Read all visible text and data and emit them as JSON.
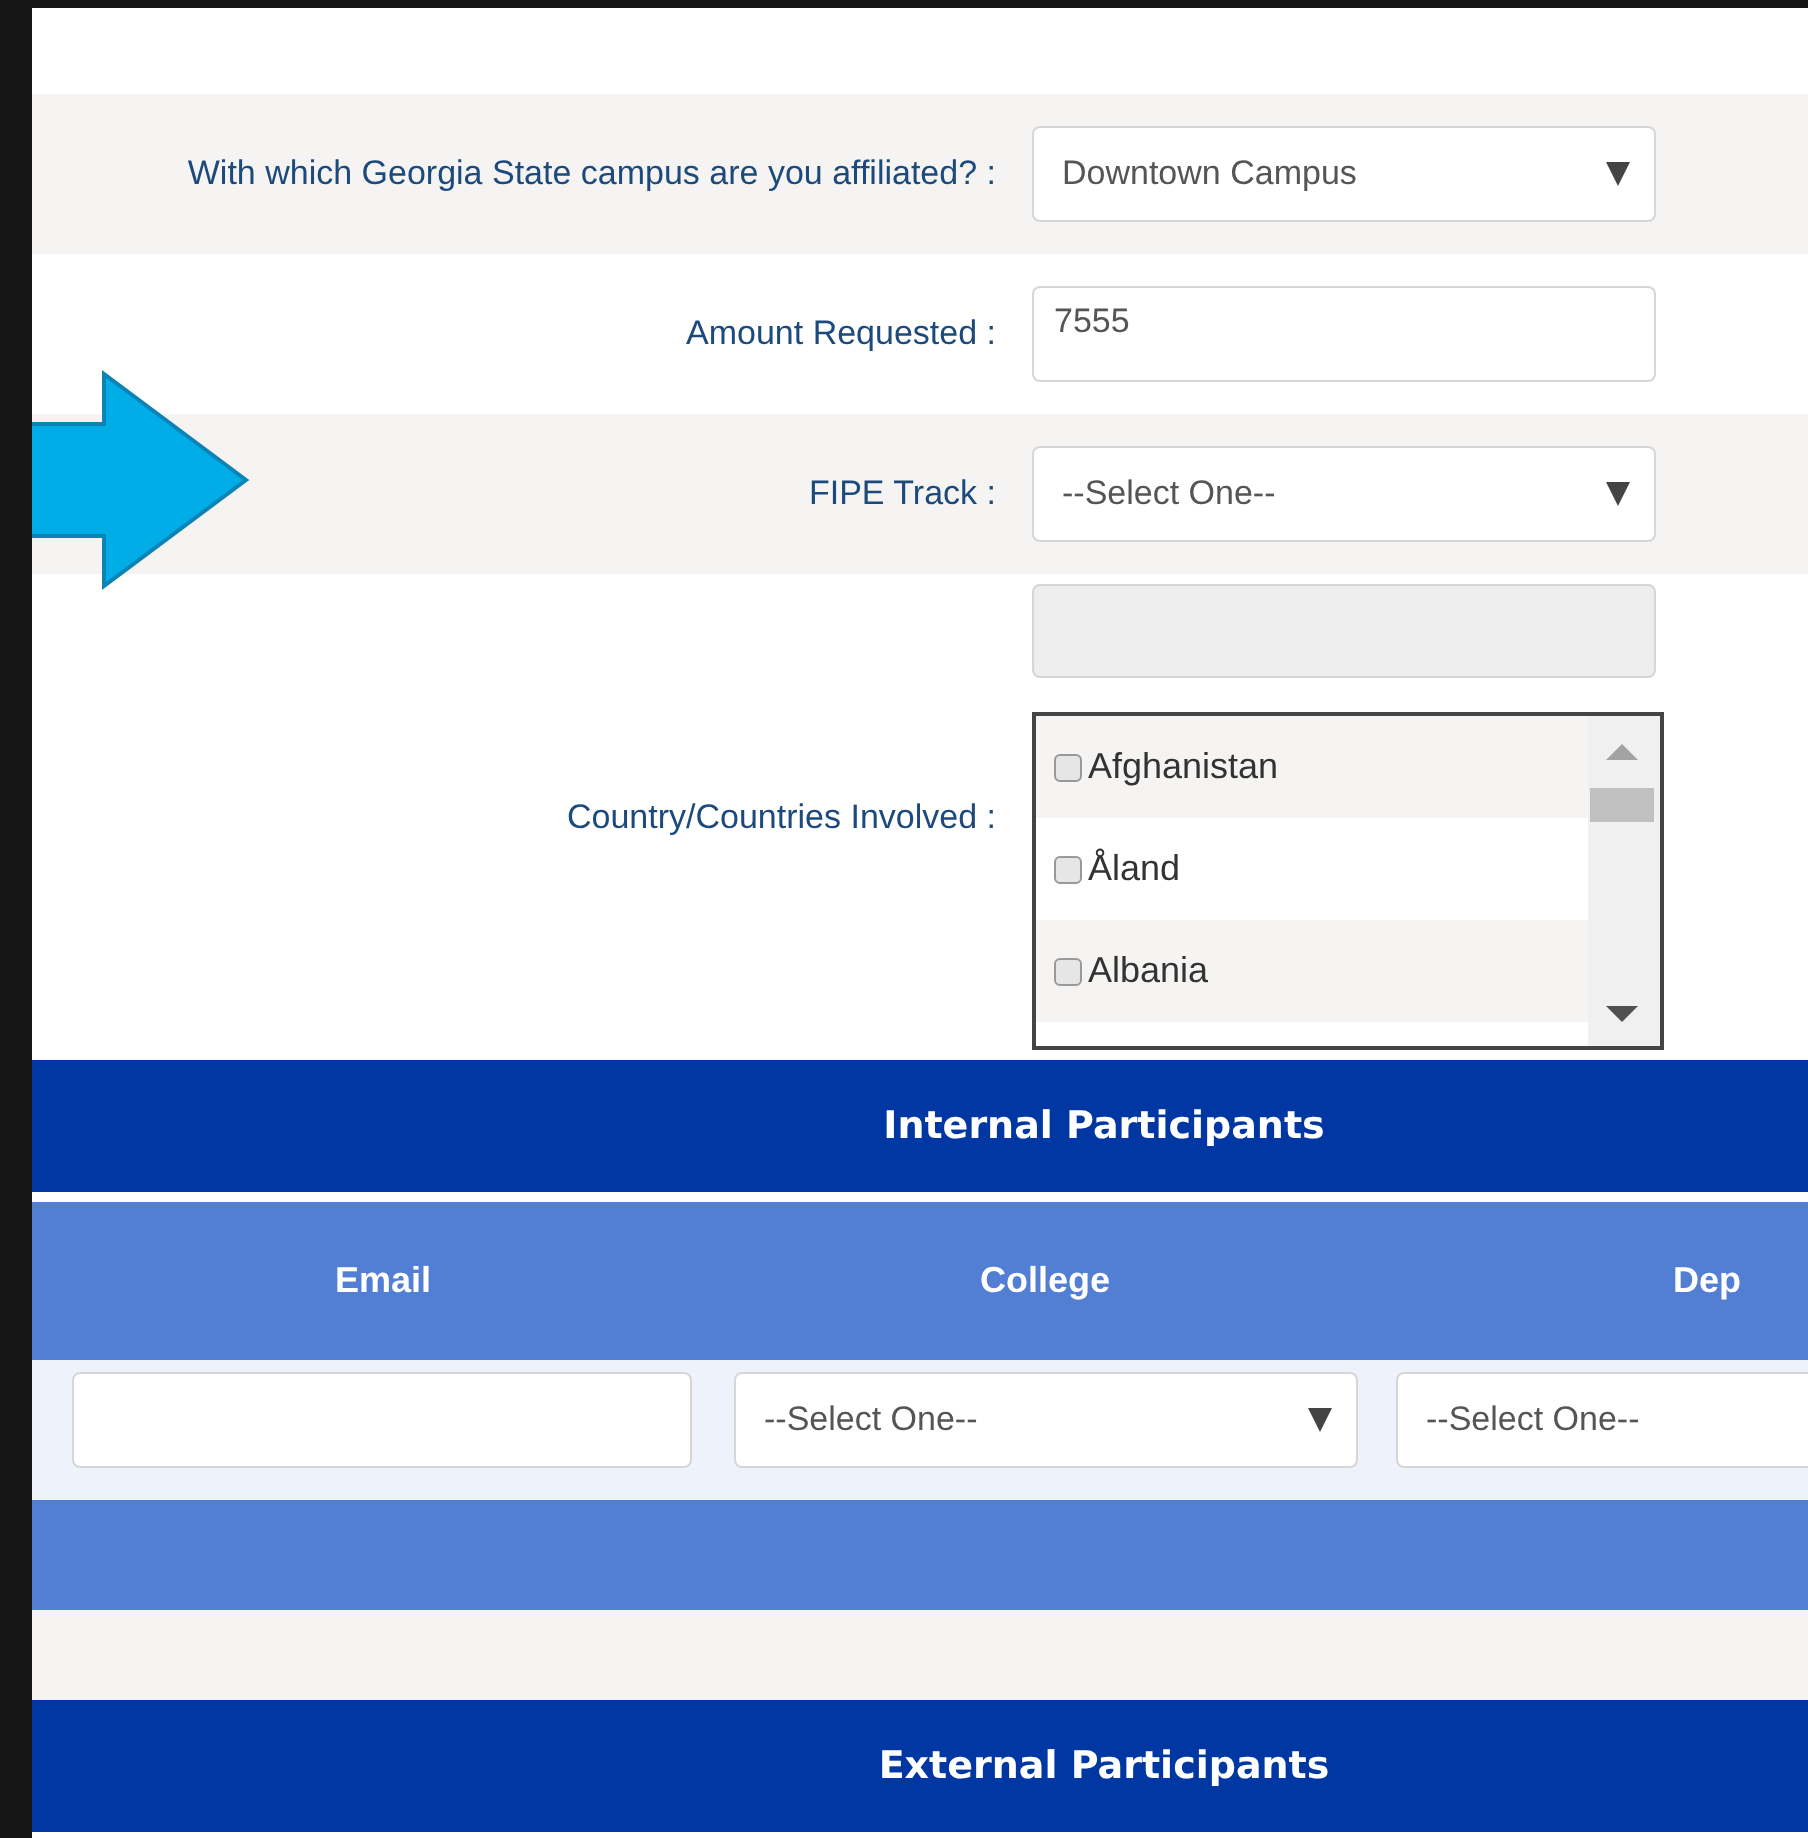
{
  "fields": [
    {
      "kind": "select",
      "label": "With which Georgia State campus are you affiliated? :",
      "value": "Downtown Campus"
    },
    {
      "kind": "input",
      "label": "Amount Requested :",
      "value": "7555"
    },
    {
      "kind": "select",
      "label": "FIPE Track :",
      "value": "--Select One--"
    },
    {
      "kind": "countries",
      "label": "Country/Countries Involved :",
      "disabled": true,
      "options": [
        {
          "name": "Afghanistan",
          "checked": false
        },
        {
          "name": "Åland",
          "checked": false
        },
        {
          "name": "Albania",
          "checked": false
        }
      ]
    }
  ],
  "internal_participants": {
    "title": "Internal Participants",
    "columns": [
      "Email",
      "College",
      "Dep"
    ],
    "row": [
      {
        "kind": "input"
      },
      {
        "kind": "select",
        "value": "--Select One--"
      },
      {
        "kind": "select",
        "value": "--Select One--"
      }
    ]
  },
  "external_participants": {
    "title": "External Participants"
  }
}
